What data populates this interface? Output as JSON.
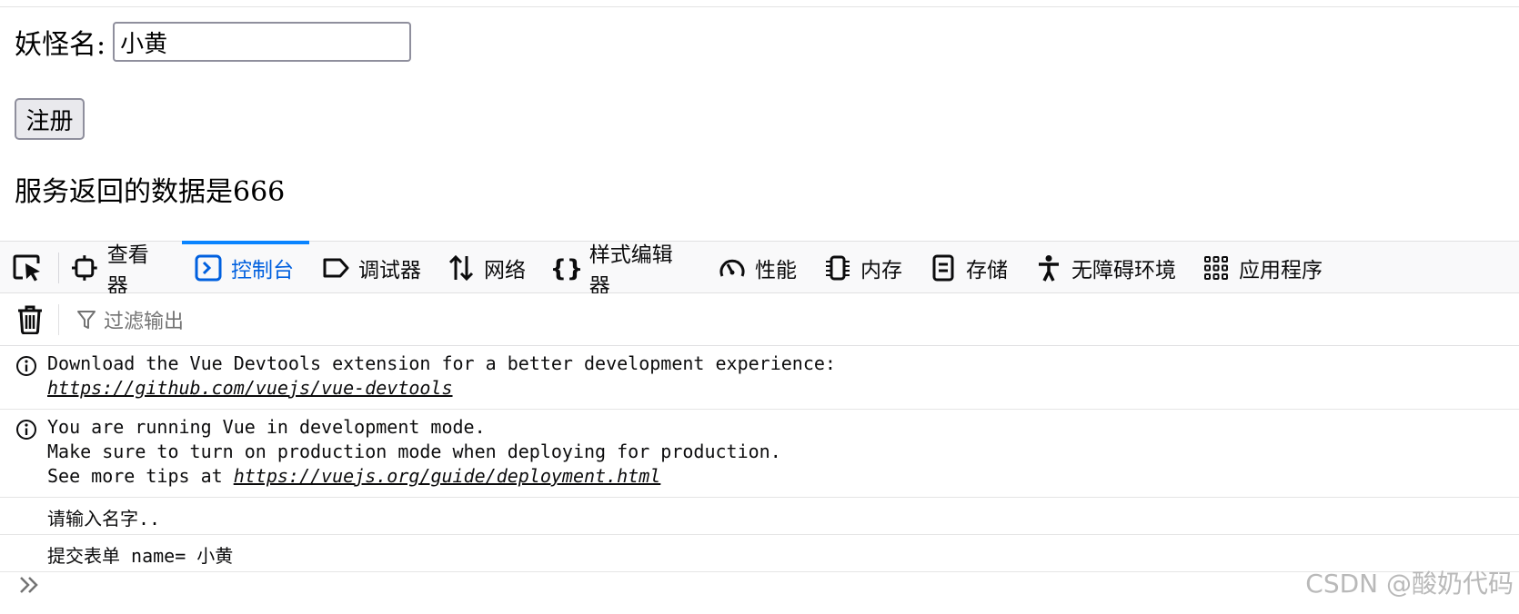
{
  "form": {
    "label": "妖怪名:",
    "input_value": "小黄",
    "submit_label": "注册",
    "result_text": "服务返回的数据是666"
  },
  "devtools": {
    "accent_color": "#0a84ff",
    "tabs": [
      {
        "label": "查看器",
        "icon": "inspector-icon"
      },
      {
        "label": "控制台",
        "icon": "console-icon",
        "selected": true
      },
      {
        "label": "调试器",
        "icon": "debugger-icon"
      },
      {
        "label": "网络",
        "icon": "network-icon"
      },
      {
        "label": "样式编辑器",
        "icon": "style-editor-icon"
      },
      {
        "label": "性能",
        "icon": "performance-icon"
      },
      {
        "label": "内存",
        "icon": "memory-icon"
      },
      {
        "label": "存储",
        "icon": "storage-icon"
      },
      {
        "label": "无障碍环境",
        "icon": "accessibility-icon"
      },
      {
        "label": "应用程序",
        "icon": "application-icon"
      }
    ],
    "filter_placeholder": "过滤输出",
    "messages": {
      "m1": {
        "line1": "Download the Vue Devtools extension for a better development experience:",
        "link": "https://github.com/vuejs/vue-devtools"
      },
      "m2": {
        "line1": "You are running Vue in development mode.",
        "line2": "Make sure to turn on production mode when deploying for production.",
        "line3_prefix": "See more tips at ",
        "link": "https://vuejs.org/guide/deployment.html"
      },
      "m3": {
        "text": "请输入名字.."
      },
      "m4": {
        "text": "提交表单 name= 小黄"
      }
    }
  },
  "watermark": "CSDN @酸奶代码"
}
